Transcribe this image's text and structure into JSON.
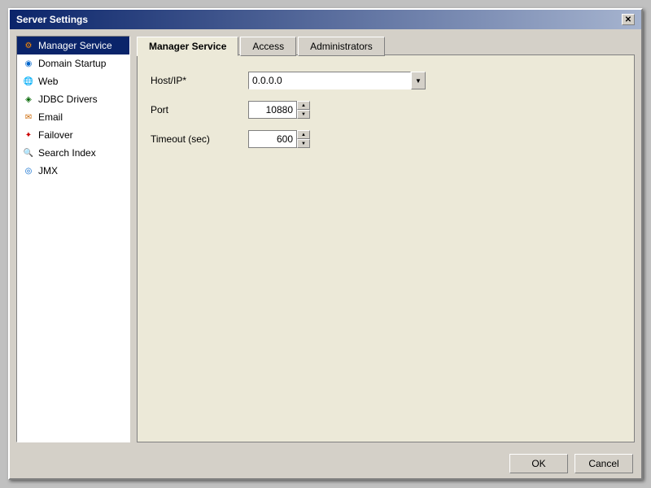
{
  "dialog": {
    "title": "Server Settings",
    "close_label": "✕"
  },
  "sidebar": {
    "items": [
      {
        "id": "manager-service",
        "label": "Manager Service",
        "icon": "⚙",
        "icon_class": "icon-manager",
        "active": true
      },
      {
        "id": "domain-startup",
        "label": "Domain Startup",
        "icon": "◉",
        "icon_class": "icon-domain"
      },
      {
        "id": "web",
        "label": "Web",
        "icon": "🌐",
        "icon_class": "icon-web"
      },
      {
        "id": "jdbc-drivers",
        "label": "JDBC Drivers",
        "icon": "◈",
        "icon_class": "icon-jdbc"
      },
      {
        "id": "email",
        "label": "Email",
        "icon": "✉",
        "icon_class": "icon-email"
      },
      {
        "id": "failover",
        "label": "Failover",
        "icon": "✦",
        "icon_class": "icon-failover"
      },
      {
        "id": "search-index",
        "label": "Search Index",
        "icon": "🔍",
        "icon_class": "icon-search"
      },
      {
        "id": "jmx",
        "label": "JMX",
        "icon": "◎",
        "icon_class": "icon-jmx"
      }
    ]
  },
  "tabs": [
    {
      "id": "manager-service",
      "label": "Manager Service",
      "active": true
    },
    {
      "id": "access",
      "label": "Access"
    },
    {
      "id": "administrators",
      "label": "Administrators"
    }
  ],
  "form": {
    "host_label": "Host/IP*",
    "host_value": "0.0.0.0",
    "host_placeholder": "0.0.0.0",
    "port_label": "Port",
    "port_value": "10880",
    "timeout_label": "Timeout (sec)",
    "timeout_value": "600",
    "combo_arrow": "▼",
    "spinner_up": "▲",
    "spinner_down": "▼"
  },
  "footer": {
    "ok_label": "OK",
    "cancel_label": "Cancel"
  }
}
